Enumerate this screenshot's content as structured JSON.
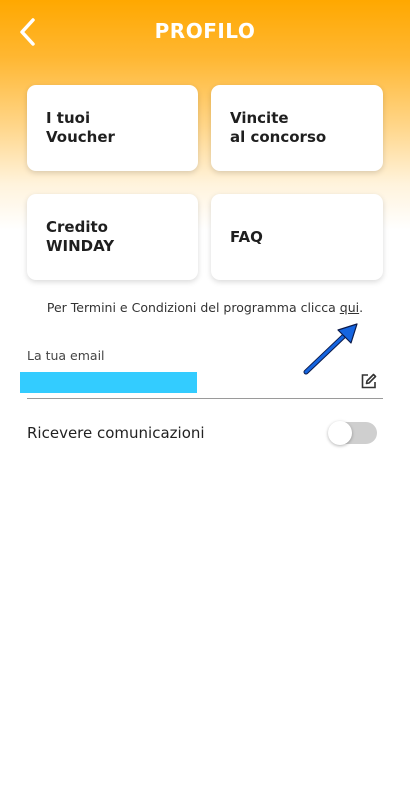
{
  "header": {
    "title": "PROFILO",
    "back_icon": "chevron-left-icon",
    "gradient_top_color": "#ffa800"
  },
  "cards": [
    {
      "label": "I tuoi\nVoucher"
    },
    {
      "label": "Vincite\nal concorso"
    },
    {
      "label": "Credito\nWINDAY"
    },
    {
      "label": "FAQ"
    }
  ],
  "terms": {
    "text_before": "Per Termini e Condizioni del programma clicca ",
    "link_text": "qui",
    "text_after": "."
  },
  "annotation": {
    "arrow_color": "#1565e0",
    "arrow_icon": "arrow-icon"
  },
  "email": {
    "label": "La tua email",
    "value_redacted": true,
    "redaction_color": "#33ccff",
    "edit_icon": "edit-icon"
  },
  "communications": {
    "label": "Ricevere comunicazioni",
    "toggle_on": false
  }
}
